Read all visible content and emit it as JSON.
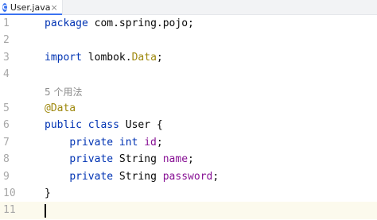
{
  "tab": {
    "icon_letter": "C",
    "filename": "User.java",
    "close": "×"
  },
  "lines": [
    {
      "n": "1",
      "parts": [
        [
          "kw",
          "package"
        ],
        [
          "t",
          " com.spring.pojo;"
        ]
      ]
    },
    {
      "n": "2",
      "parts": []
    },
    {
      "n": "3",
      "parts": [
        [
          "kw",
          "import"
        ],
        [
          "t",
          " lombok."
        ],
        [
          "ann",
          "Data"
        ],
        [
          "t",
          ";"
        ]
      ]
    },
    {
      "n": "4",
      "parts": []
    },
    {
      "n": "",
      "parts": [
        [
          "hint",
          "5 个用法"
        ]
      ]
    },
    {
      "n": "5",
      "parts": [
        [
          "ann",
          "@Data"
        ]
      ]
    },
    {
      "n": "6",
      "parts": [
        [
          "kw",
          "public class"
        ],
        [
          "t",
          " User {"
        ]
      ]
    },
    {
      "n": "7",
      "parts": [
        [
          "t",
          "    "
        ],
        [
          "kw",
          "private int"
        ],
        [
          "t",
          " "
        ],
        [
          "fld",
          "id"
        ],
        [
          "t",
          ";"
        ]
      ]
    },
    {
      "n": "8",
      "parts": [
        [
          "t",
          "    "
        ],
        [
          "kw",
          "private"
        ],
        [
          "t",
          " String "
        ],
        [
          "fld",
          "name"
        ],
        [
          "t",
          ";"
        ]
      ]
    },
    {
      "n": "9",
      "parts": [
        [
          "t",
          "    "
        ],
        [
          "kw",
          "private"
        ],
        [
          "t",
          " String "
        ],
        [
          "fld",
          "password"
        ],
        [
          "t",
          ";"
        ]
      ]
    },
    {
      "n": "10",
      "parts": [
        [
          "t",
          "}"
        ]
      ]
    },
    {
      "n": "11",
      "parts": [],
      "current": true
    }
  ]
}
